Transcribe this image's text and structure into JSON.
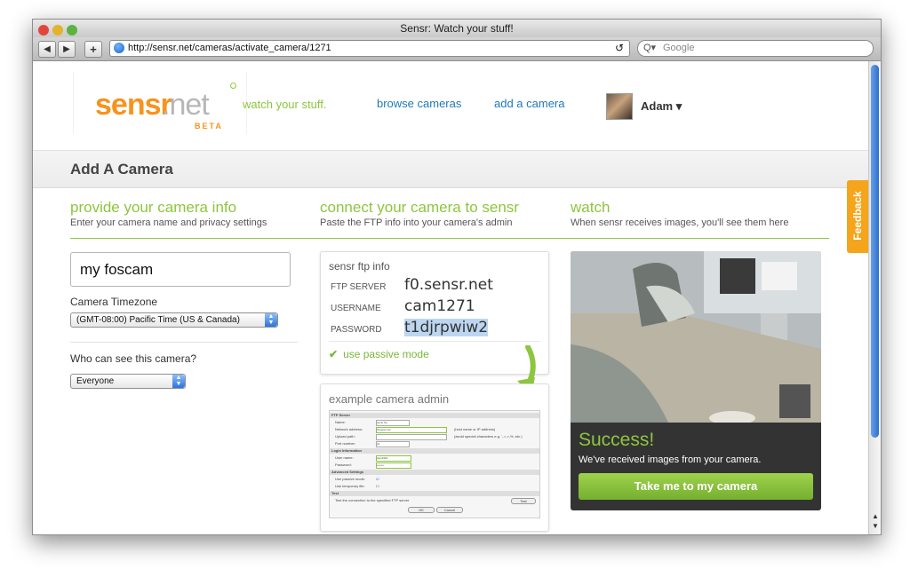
{
  "browser": {
    "title": "Sensr: Watch your stuff!",
    "back_glyph": "◀",
    "forward_glyph": "▶",
    "add_glyph": "+",
    "url": "http://sensr.net/cameras/activate_camera/1271",
    "reload_glyph": "↺",
    "search_icon_glyph": "Q▾",
    "search_placeholder": "Google",
    "scroll_up": "▲",
    "scroll_down": "▼"
  },
  "site": {
    "logo_word": "sensr",
    "logo_net": ".net",
    "logo_beta": "BETA",
    "tagline": "watch your stuff.",
    "nav": [
      {
        "label": "browse cameras"
      },
      {
        "label": "add a camera"
      }
    ],
    "user": {
      "name": "Adam ▾"
    }
  },
  "page": {
    "title": "Add A Camera"
  },
  "columns": [
    {
      "title": "provide your camera info",
      "subtitle": "Enter your camera name and privacy settings"
    },
    {
      "title": "connect your camera to sensr",
      "subtitle": "Paste the FTP info into your camera's admin"
    },
    {
      "title": "watch",
      "subtitle": "When sensr receives images, you'll see them here"
    }
  ],
  "form": {
    "camera_name": "my foscam",
    "timezone_label": "Camera Timezone",
    "timezone_value": "(GMT-08:00) Pacific Time (US & Canada)",
    "privacy_label": "Who can see this camera?",
    "privacy_value": "Everyone"
  },
  "ftp": {
    "title": "sensr ftp info",
    "server_label": "FTP SERVER",
    "server_value": "f0.sensr.net",
    "username_label": "USERNAME",
    "username_value": "cam1271",
    "password_label": "PASSWORD",
    "password_value": "t1djrpwiw2",
    "passive_check": "✔",
    "passive_label": "use passive mode"
  },
  "example": {
    "title": "example camera admin",
    "ftp_server": "FTP Server",
    "name": "Name:",
    "name_value": "sensr ftp",
    "network_address": "Network address:",
    "network_value": "f0.sensr.net",
    "network_hint": "(host name or IP address)",
    "upload_path": "Upload path:",
    "upload_hint": "(avoid special characters e.g. ',.<,>,%, etc.)",
    "port": "Port number:",
    "port_value": "21",
    "login_info": "Login Information",
    "user_name": "User name:",
    "user_value": "cam1901",
    "password": "Password:",
    "password_value": "••••••••",
    "advanced": "Advanced Settings",
    "passive": "Use passive mode:",
    "temp_file": "Use temporary file:",
    "test": "Test",
    "test_desc": "Test the connection to the specified FTP server",
    "test_btn": "Test",
    "ok": "OK",
    "cancel": "Cancel"
  },
  "watch": {
    "success": "Success!",
    "message": "We've received images from your camera.",
    "cta": "Take me to my camera"
  },
  "feedback": {
    "label": "Feedback"
  },
  "colors": {
    "accent_green": "#8dc63f",
    "logo_orange": "#f7931e",
    "link_blue": "#1f7ab8",
    "feedback_orange": "#f4a51c"
  }
}
